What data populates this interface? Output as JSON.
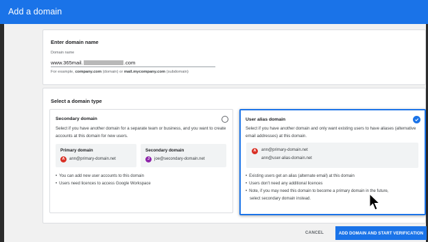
{
  "header": {
    "title": "Add a domain"
  },
  "domain_section": {
    "title": "Enter domain name",
    "field_label": "Domain name",
    "value_prefix": "www.365mail.",
    "value_suffix": ".com",
    "hint_prefix": "For example, ",
    "hint_example1": "company.com",
    "hint_mid": " (domain) or ",
    "hint_example2": "mail.mycompany.com",
    "hint_suffix": " (subdomain)"
  },
  "type_section": {
    "title": "Select a domain type",
    "secondary": {
      "title": "Secondary domain",
      "description": "Select if you have another domain for a separate team or business, and you want to create accounts at this domain for new users.",
      "selected": false,
      "primary_box": {
        "title": "Primary domain",
        "avatar": "A",
        "email": "ann@primary-domain.net"
      },
      "secondary_box": {
        "title": "Secondary domain",
        "avatar": "J",
        "email": "joe@secondary-domain.net"
      },
      "bullets": [
        "You can add new user accounts to this domain",
        "Users need licences to access Google Workspace"
      ]
    },
    "alias": {
      "title": "User alias domain",
      "description": "Select if you have another domain and only want existing users to have aliases (alternative email addresses) at this domain.",
      "selected": true,
      "avatar": "A",
      "email1": "ann@primary-domain.net",
      "email2": "ann@user-alias-domain.net",
      "bullets": [
        "Existing users get an alias (alternate email) at this domain",
        "Users don't need any additional licences",
        "Note, if you may need this domain to become a primary domain in the future,",
        "select secondary domain instead."
      ]
    }
  },
  "actions": {
    "cancel_label": "CANCEL",
    "submit_label": "ADD DOMAIN AND START VERIFICATION"
  },
  "colors": {
    "accent": "#1a73e8",
    "avatar_red": "#d93025",
    "avatar_purple": "#8e24aa"
  }
}
